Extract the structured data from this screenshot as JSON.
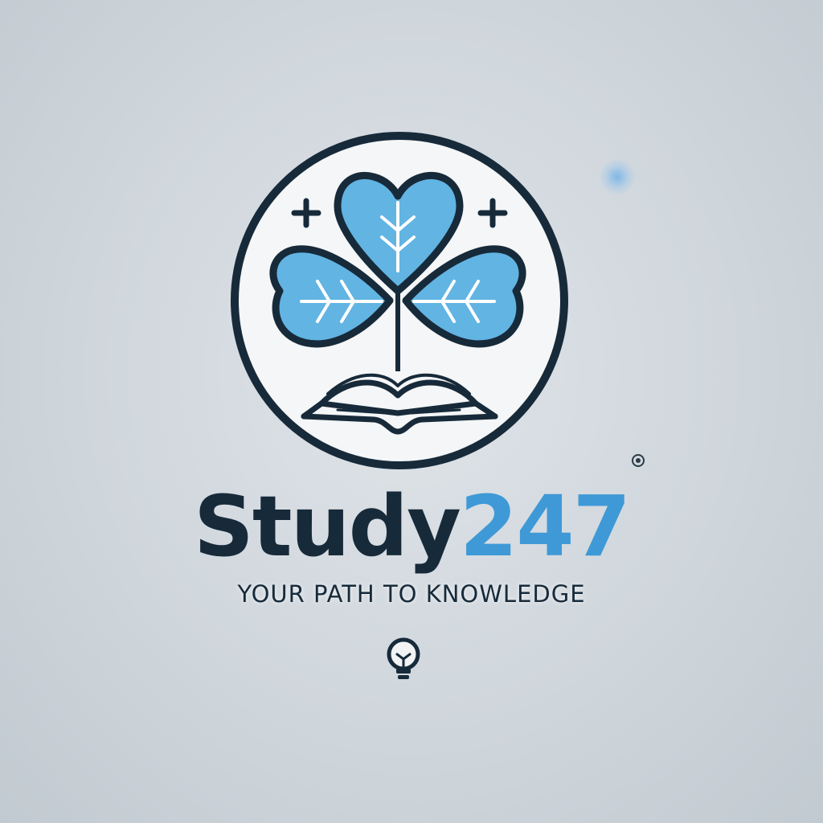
{
  "brand": {
    "name_word": "Study",
    "name_digits": "247",
    "tagline": "Your Path to Knowledge"
  },
  "colors": {
    "navy": "#172a3a",
    "accent_blue": "#3f99d6",
    "leaf_blue": "#62b4e2",
    "background": "#cfd6dc"
  },
  "icons": {
    "emblem": "clover-book-icon",
    "sparkles": "plus-sparkle-icon",
    "registered": "registered-mark-icon",
    "footer": "lightbulb-icon"
  }
}
